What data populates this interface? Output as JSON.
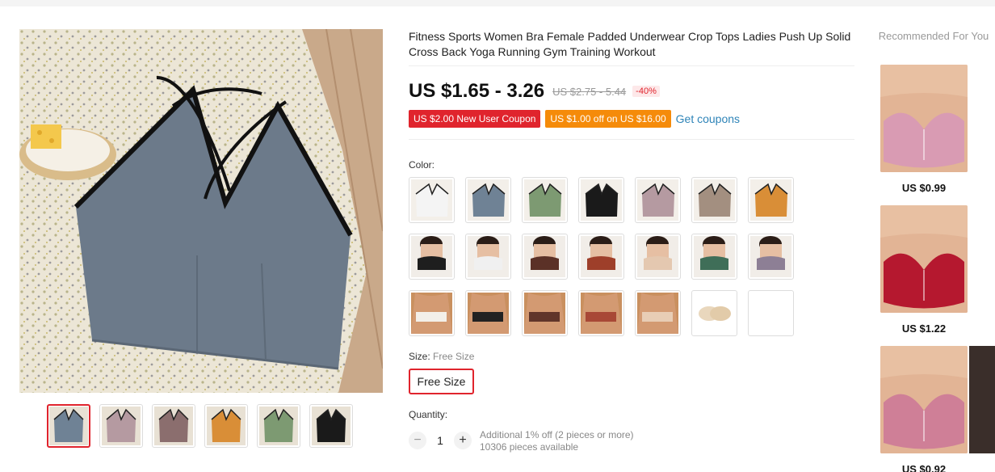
{
  "product": {
    "title": "Fitness Sports Women Bra Female Padded Underwear Crop Tops Ladies Push Up Solid Cross Back Yoga Running Gym Training Workout",
    "price": "US $1.65 - 3.26",
    "original_price": "US $2.75 - 5.44",
    "discount": "-40%"
  },
  "coupons": {
    "new_user": "US $2.00 New User Coupon",
    "off": "US $1.00 off on US $16.00",
    "get_link": "Get coupons"
  },
  "color": {
    "label": "Color:",
    "swatches": [
      {
        "name": "white",
        "color": "#f4f4f4"
      },
      {
        "name": "blue-grey",
        "color": "#6f8295"
      },
      {
        "name": "green",
        "color": "#7d9a72"
      },
      {
        "name": "black",
        "color": "#1a1a1a"
      },
      {
        "name": "mauve",
        "color": "#b59aa1"
      },
      {
        "name": "taupe",
        "color": "#a38f80"
      },
      {
        "name": "orange",
        "color": "#d98e37"
      },
      {
        "name": "black-model",
        "color": "#1e1e1e"
      },
      {
        "name": "white-model",
        "color": "#f0f0f0"
      },
      {
        "name": "brown-model",
        "color": "#5b3127"
      },
      {
        "name": "rust-model",
        "color": "#9e3f2a"
      },
      {
        "name": "beige-model",
        "color": "#e4c8b0"
      },
      {
        "name": "green-model",
        "color": "#3f6e58"
      },
      {
        "name": "purple-model",
        "color": "#8d7f95"
      },
      {
        "name": "white-back",
        "color": "#f3efe9"
      },
      {
        "name": "black-back",
        "color": "#222222"
      },
      {
        "name": "brown-back",
        "color": "#60352a"
      },
      {
        "name": "rust-back",
        "color": "#a84836"
      },
      {
        "name": "beige-back",
        "color": "#e8cdb5"
      },
      {
        "name": "pads",
        "color": "#e9d7bd"
      },
      {
        "name": "empty",
        "color": "#ffffff"
      }
    ]
  },
  "size": {
    "label": "Size:",
    "selected": "Free Size",
    "option": "Free Size"
  },
  "quantity": {
    "label": "Quantity:",
    "minus": "−",
    "value": "1",
    "plus": "+",
    "note": "Additional 1% off (2 pieces or more)",
    "available": "10306 pieces available"
  },
  "thumbnails": [
    {
      "color": "#6f8295"
    },
    {
      "color": "#b59aa1"
    },
    {
      "color": "#8b6e6e"
    },
    {
      "color": "#d98e37"
    },
    {
      "color": "#7d9a72"
    },
    {
      "color": "#1a1a1a"
    }
  ],
  "recommended": {
    "title": "Recommended For You",
    "items": [
      {
        "price": "US $0.99",
        "color": "#d99bb3"
      },
      {
        "price": "US $1.22",
        "color": "#b5182f"
      },
      {
        "price": "US $0.92",
        "color": "#cf7f97"
      }
    ]
  }
}
